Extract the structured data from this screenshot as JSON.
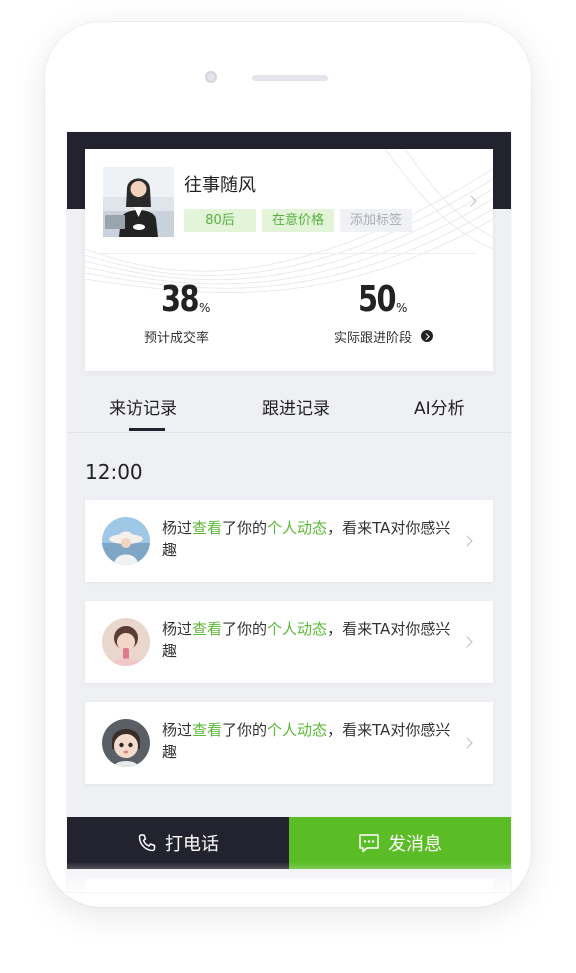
{
  "profile": {
    "name": "往事随风",
    "tags": [
      {
        "label": "80后",
        "style": "green"
      },
      {
        "label": "在意价格",
        "style": "green"
      },
      {
        "label": "添加标签",
        "style": "grey"
      }
    ]
  },
  "stats": [
    {
      "value": "38",
      "unit": "%",
      "label": "预计成交率"
    },
    {
      "value": "50",
      "unit": "%",
      "label": "实际跟进阶段"
    }
  ],
  "tabs": [
    {
      "label": "来访记录",
      "active": true
    },
    {
      "label": "跟进记录",
      "active": false
    },
    {
      "label": "AI分析",
      "active": false
    }
  ],
  "timeline": {
    "time": "12:00",
    "records": [
      {
        "who": "杨过",
        "verb": "查看",
        "mid": "了你的",
        "obj": "个人动态",
        "end": "，看来TA对你感兴趣",
        "avatar": "avatar-hat-icon"
      },
      {
        "who": "杨过",
        "verb": "查看",
        "mid": "了你的",
        "obj": "个人动态",
        "end": "，看来TA对你感兴趣",
        "avatar": "avatar-girl-icon"
      },
      {
        "who": "杨过",
        "verb": "查看",
        "mid": "了你的",
        "obj": "个人动态",
        "end": "，看来TA对你感兴趣",
        "avatar": "avatar-baby-icon"
      }
    ]
  },
  "actions": {
    "call_label": "打电话",
    "message_label": "发消息"
  },
  "colors": {
    "dark": "#23222f",
    "green": "#5bbd26",
    "highlight": "#5bb934",
    "background": "#eff0f4"
  }
}
